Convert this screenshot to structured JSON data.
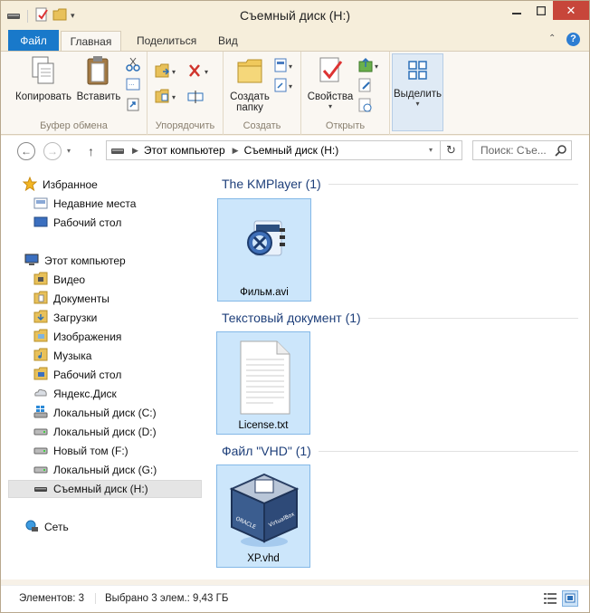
{
  "window": {
    "title": "Съемный диск (H:)"
  },
  "ribbon_tabs": {
    "file": "Файл",
    "home": "Главная",
    "share": "Поделиться",
    "view": "Вид"
  },
  "ribbon": {
    "copy": "Копировать",
    "paste": "Вставить",
    "clipboard_group": "Буфер обмена",
    "organize_group": "Упорядочить",
    "new_folder_line1": "Создать",
    "new_folder_line2": "папку",
    "create_group": "Создать",
    "properties": "Свойства",
    "open_group": "Открыть",
    "select": "Выделить"
  },
  "address": {
    "segment1": "Этот компьютер",
    "segment2": "Съемный диск (H:)",
    "search_placeholder": "Поиск: Съе..."
  },
  "navpane": {
    "favorites": "Избранное",
    "favorites_items": [
      "Недавние места",
      "Рабочий стол"
    ],
    "this_pc": "Этот компьютер",
    "pc_items": [
      "Видео",
      "Документы",
      "Загрузки",
      "Изображения",
      "Музыка",
      "Рабочий стол",
      "Яндекс.Диск",
      "Локальный диск (C:)",
      "Локальный диск (D:)",
      "Новый том (F:)",
      "Локальный диск (G:)",
      "Съемный диск (H:)"
    ],
    "network": "Сеть"
  },
  "groups": [
    {
      "header": "The KMPlayer (1)",
      "file": "Фильм.avi"
    },
    {
      "header": "Текстовый документ (1)",
      "file": "License.txt"
    },
    {
      "header": "Файл \"VHD\" (1)",
      "file": "XP.vhd"
    }
  ],
  "status": {
    "items": "Элементов: 3",
    "selected": "Выбрано 3 элем.: 9,43 ГБ"
  }
}
